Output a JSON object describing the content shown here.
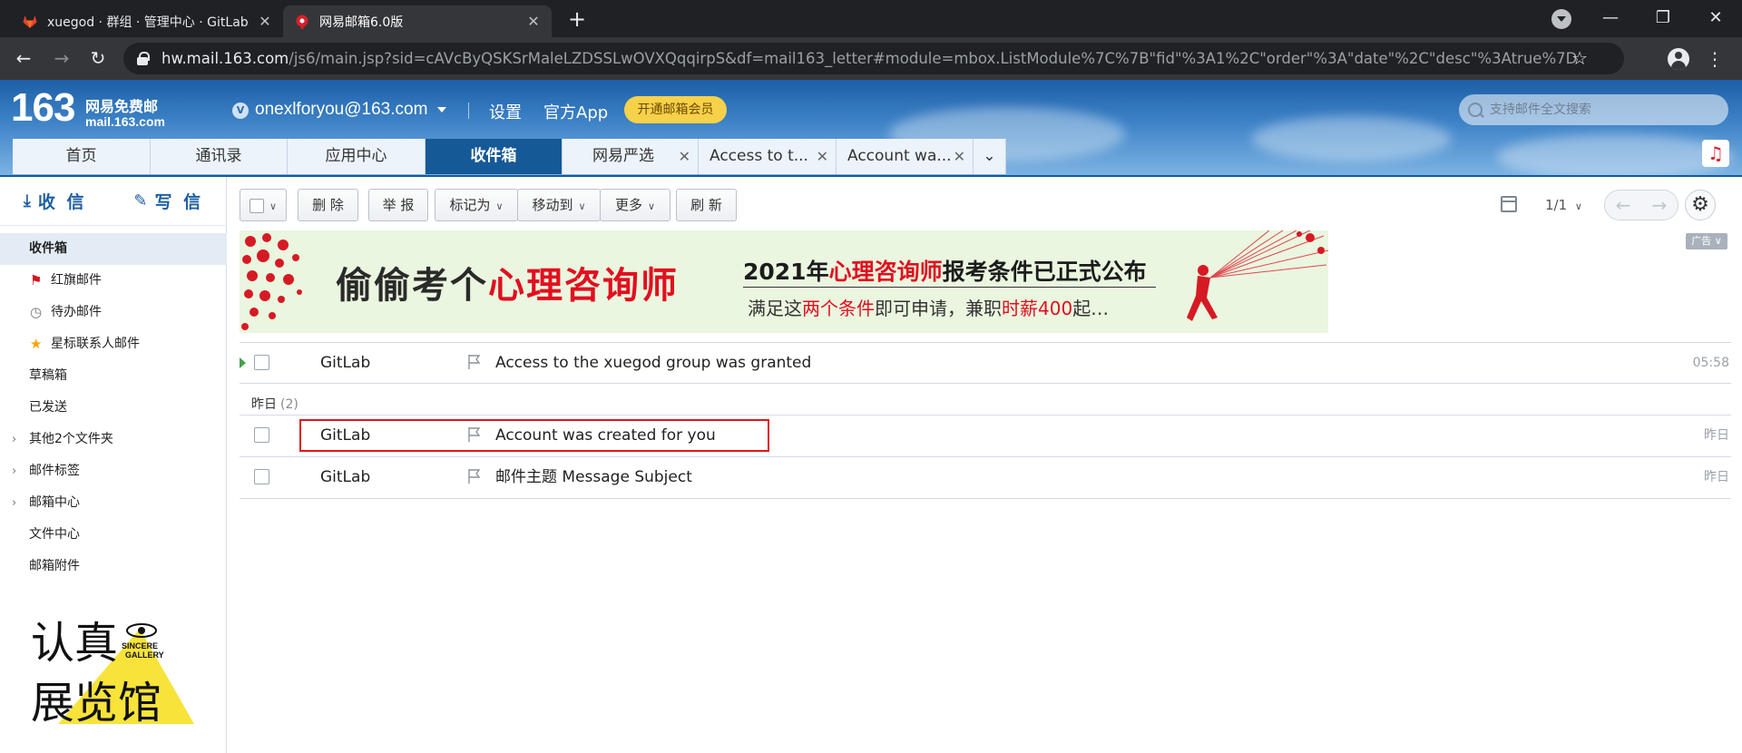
{
  "browser": {
    "tabs": [
      {
        "title": "xuegod · 群组 · 管理中心 · GitLab",
        "active": false
      },
      {
        "title": "网易邮箱6.0版",
        "active": true
      }
    ],
    "new_tab": "+",
    "url_host": "hw.mail.163.com",
    "url_path": "/js6/main.jsp?sid=cAVcByQSKSrMaleLZDSSLwOVXQqqirpS&df=mail163_letter#module=mbox.ListModule%7C%7B\"fid\"%3A1%2C\"order\"%3A\"date\"%2C\"desc\"%3Atrue%7D"
  },
  "header": {
    "logo_num": "163",
    "logo_cn": "网易免费邮",
    "logo_domain": "mail.163.com",
    "vip_badge": "V",
    "user": "onexlforyou@163.com",
    "links": [
      "设置",
      "官方App"
    ],
    "vip_button": "开通邮箱会员",
    "search_placeholder": "支持邮件全文搜索",
    "tabs": [
      {
        "label": "首页"
      },
      {
        "label": "通讯录"
      },
      {
        "label": "应用中心"
      },
      {
        "label": "收件箱",
        "active": true
      },
      {
        "label": "网易严选",
        "closable": true
      },
      {
        "label": "Access to t...",
        "closable": true
      },
      {
        "label": "Account wa...",
        "closable": true
      }
    ]
  },
  "sidebar": {
    "receive": "收 信",
    "compose": "写 信",
    "folders": [
      {
        "label": "收件箱",
        "active": true
      },
      {
        "label": "红旗邮件",
        "icon": "red-flag-icon"
      },
      {
        "label": "待办邮件",
        "icon": "clock-icon"
      },
      {
        "label": "星标联系人邮件",
        "icon": "star-icon"
      },
      {
        "label": "草稿箱"
      },
      {
        "label": "已发送"
      },
      {
        "label": "其他2个文件夹",
        "expandable": true
      },
      {
        "label": "邮件标签",
        "expandable": true
      },
      {
        "label": "邮箱中心",
        "expandable": true
      },
      {
        "label": "文件中心"
      },
      {
        "label": "邮箱附件"
      }
    ],
    "promo": {
      "line1": "认真",
      "line2": "展览馆",
      "en1": "SINCERE",
      "en2": "GALLERY"
    }
  },
  "toolbar": {
    "buttons": [
      "删 除",
      "举 报",
      "标记为",
      "移动到",
      "更多",
      "刷 新"
    ],
    "page": "1/1",
    "prev": "←",
    "next": "→"
  },
  "ad": {
    "title_a": "偷偷考个",
    "title_b": "心理咨询师",
    "line1_a": "2021年",
    "line1_b": "心理咨询师",
    "line1_c": "报考条件已正式公布",
    "line2_a": "满足这",
    "line2_b": "两个条件",
    "line2_c": "即可申请，兼职",
    "line2_d": "时薪400",
    "line2_e": "起…",
    "badge": "广告"
  },
  "mails": {
    "today": [
      {
        "sender": "GitLab",
        "subject": "Access to the xuegod group was granted",
        "time": "05:58",
        "unread": true
      }
    ],
    "group_label": "昨日",
    "group_count": "(2)",
    "yesterday": [
      {
        "sender": "GitLab",
        "subject": "Account was created for you",
        "time": "昨日"
      },
      {
        "sender": "GitLab",
        "subject": "邮件主题 Message Subject",
        "time": "昨日"
      }
    ]
  }
}
